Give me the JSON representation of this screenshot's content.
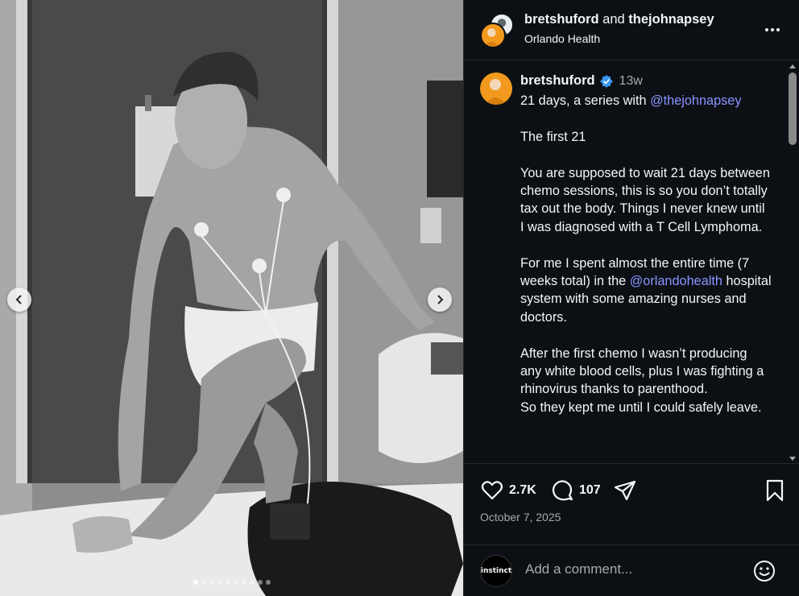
{
  "post": {
    "collaborators": [
      "bretshuford",
      "thejohnapsey"
    ],
    "and_text": " and ",
    "location": "Orlando Health",
    "carousel": {
      "slide_count": 10,
      "active_index": 0
    }
  },
  "caption": {
    "username": "bretshuford",
    "verified": true,
    "time": "13w",
    "line1_prefix": "21 days, a series with ",
    "line1_mention": "@thejohnapsey",
    "para1": "The first 21",
    "para2": "You are supposed to wait 21 days between chemo sessions, this is so you don’t totally tax out the body. Things I never knew until I was diagnosed with a T Cell Lymphoma.",
    "para3_prefix": "For me I spent almost the entire time (7 weeks total) in the ",
    "para3_mention": "@orlandohealth",
    "para3_suffix": " hospital system with some amazing nurses and doctors.",
    "para4": "After the first chemo I wasn’t producing any white blood cells, plus I was fighting a rhinovirus thanks to parenthood.",
    "para5": "So they kept me until I could safely leave."
  },
  "actions": {
    "likes": "2.7K",
    "comments": "107"
  },
  "date": "October 7, 2025",
  "add_comment": {
    "placeholder": "Add a comment...",
    "avatar_text": "instinct"
  },
  "colors": {
    "panel_bg": "#0c1014",
    "mention": "#8a93ff",
    "verified": "#3897f0",
    "secondary_text": "#a8a8a8"
  },
  "icons": [
    "chevron-left-icon",
    "chevron-right-icon",
    "more-icon",
    "verified-icon",
    "heart-icon",
    "comment-icon",
    "share-icon",
    "bookmark-icon",
    "emoji-icon"
  ]
}
